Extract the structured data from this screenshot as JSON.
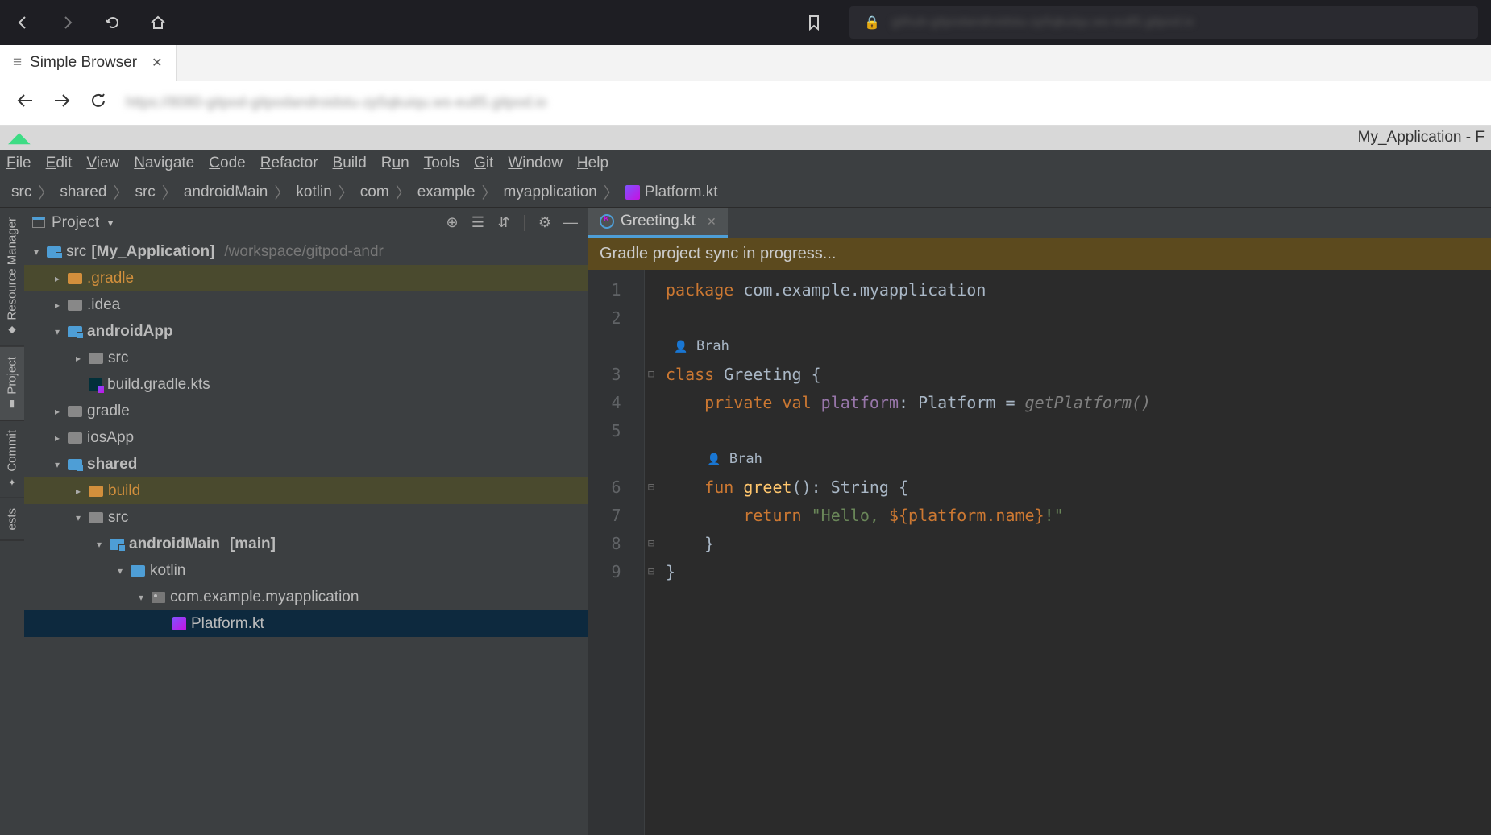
{
  "top_toolbar": {
    "url_blurred": "github-gitpodandroidstu-zp5qkuiqu.ws-eu85.gitpod.io"
  },
  "vscode_tab": {
    "label": "Simple Browser"
  },
  "nav_bar": {
    "url_blurred": "https://8080-gitpod-gitpodandroidstu-zp5qkuiqu.ws-eu85.gitpod.io"
  },
  "as_title": "My_Application - F",
  "menu": [
    "File",
    "Edit",
    "View",
    "Navigate",
    "Code",
    "Refactor",
    "Build",
    "Run",
    "Tools",
    "Git",
    "Window",
    "Help"
  ],
  "breadcrumb": [
    "src",
    "shared",
    "src",
    "androidMain",
    "kotlin",
    "com",
    "example",
    "myapplication",
    "Platform.kt"
  ],
  "project_panel": {
    "title": "Project",
    "root_name": "src",
    "root_suffix": "[My_Application]",
    "root_path": "/workspace/gitpod-andr",
    "items": [
      {
        "indent": 1,
        "arrow": "right",
        "icon": "folder-orange",
        "name": ".gradle",
        "orange": true,
        "highlight": true
      },
      {
        "indent": 1,
        "arrow": "right",
        "icon": "folder-grey",
        "name": ".idea"
      },
      {
        "indent": 1,
        "arrow": "down",
        "icon": "module",
        "name": "androidApp",
        "bold": true
      },
      {
        "indent": 2,
        "arrow": "right",
        "icon": "folder-grey",
        "name": "src"
      },
      {
        "indent": 2,
        "arrow": "none",
        "icon": "gradle",
        "name": "build.gradle.kts"
      },
      {
        "indent": 1,
        "arrow": "right",
        "icon": "folder-grey",
        "name": "gradle"
      },
      {
        "indent": 1,
        "arrow": "right",
        "icon": "folder-grey",
        "name": "iosApp"
      },
      {
        "indent": 1,
        "arrow": "down",
        "icon": "module",
        "name": "shared",
        "bold": true
      },
      {
        "indent": 2,
        "arrow": "right",
        "icon": "folder-orange",
        "name": "build",
        "orange": true,
        "highlight": true
      },
      {
        "indent": 2,
        "arrow": "down",
        "icon": "folder-grey",
        "name": "src"
      },
      {
        "indent": 3,
        "arrow": "down",
        "icon": "module",
        "name": "androidMain",
        "bold": true,
        "suffix": "[main]"
      },
      {
        "indent": 4,
        "arrow": "down",
        "icon": "folder-blue",
        "name": "kotlin"
      },
      {
        "indent": 5,
        "arrow": "down",
        "icon": "package",
        "name": "com.example.myapplication"
      },
      {
        "indent": 6,
        "arrow": "none",
        "icon": "kt",
        "name": "Platform.kt",
        "selected": true
      }
    ]
  },
  "tool_tabs": [
    {
      "label": "Resource Manager",
      "icon": "◆"
    },
    {
      "label": "Project",
      "icon": "▮",
      "active": true
    },
    {
      "label": "Commit",
      "icon": "✦"
    },
    {
      "label": "ests",
      "icon": ""
    }
  ],
  "editor": {
    "tab_name": "Greeting.kt",
    "sync_msg": "Gradle project sync in progress...",
    "author_hint": "Brah",
    "code": {
      "line1_pkg": "package",
      "line1_name": " com.example.myapplication",
      "line3_class": "class",
      "line3_name": " Greeting {",
      "line4_priv": "    private val",
      "line4_field": " platform",
      "line4_rest1": ": Platform = ",
      "line4_call": "getPlatform()",
      "line6_fun": "    fun",
      "line6_name": " greet",
      "line6_sig": "(): String {",
      "line7_ret": "        return",
      "line7_str1": " \"Hello, ",
      "line7_tmpl": "${platform.name}",
      "line7_str2": "!\"",
      "line8": "    }",
      "line9": "}"
    },
    "line_numbers": [
      "1",
      "2",
      "",
      "3",
      "4",
      "5",
      "",
      "6",
      "7",
      "8",
      "9"
    ]
  }
}
